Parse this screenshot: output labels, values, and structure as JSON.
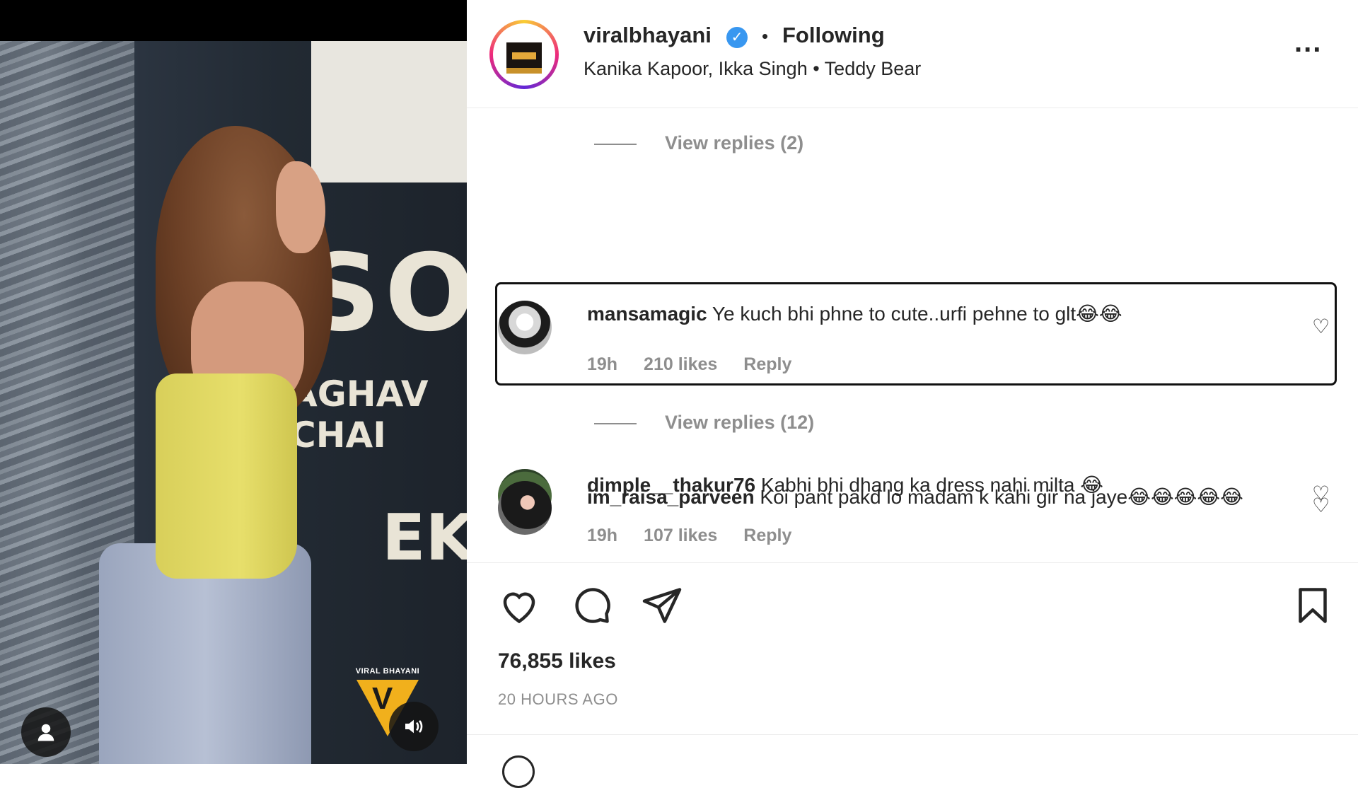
{
  "post": {
    "username": "viralbhayani",
    "separator": "•",
    "follow_state": "Following",
    "subline": "Kanika Kapoor, Ikka Singh • Teddy Bear",
    "more_label": "..."
  },
  "video": {
    "screen_text_1": "SON",
    "screen_text_2": "AGHAV CHAI",
    "screen_text_3": "EK",
    "watermark": "VIRAL BHAYANI",
    "watermark_mark": "V"
  },
  "comments": {
    "view_replies_1": "View replies (2)",
    "view_replies_2": "View replies (12)",
    "items": [
      {
        "user": "mansamagic",
        "text": "Ye kuch bhi phne to cute..urfi pehne to glt😂😂",
        "age": "19h",
        "likes": "210 likes",
        "reply": "Reply"
      },
      {
        "user": "dimple__thakur76",
        "text": "Kabhi bhi dhang ka dress nahi milta 😂",
        "age": "19h",
        "likes": "107 likes",
        "reply": "Reply"
      },
      {
        "user": "im_raisa_parveen",
        "text": "Koi pant pakd lo madam k kahi gir na jaye😂😂😂😂😂",
        "age": "",
        "likes": "",
        "reply": ""
      }
    ]
  },
  "footer": {
    "likes": "76,855 likes",
    "time": "20 HOURS AGO"
  },
  "colors": {
    "verified_blue": "#3897f0",
    "muted_text": "#8e8e8e",
    "text": "#262626",
    "watermark_yellow": "#f1b01c"
  },
  "icons": [
    "verified-icon",
    "more-icon",
    "heart-icon",
    "comment-icon",
    "share-icon",
    "bookmark-icon",
    "profile-icon",
    "volume-icon"
  ]
}
